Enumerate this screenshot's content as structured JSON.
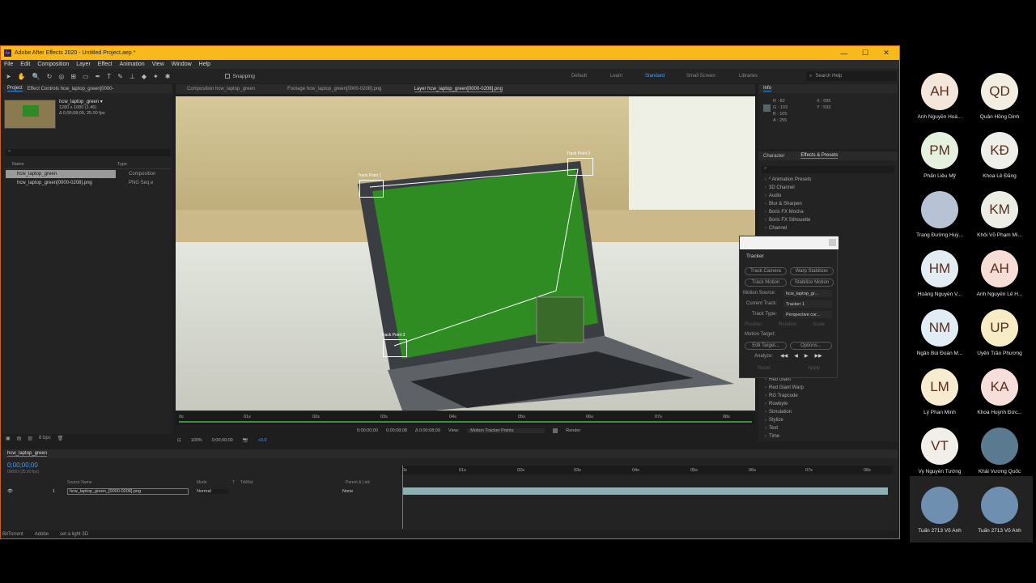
{
  "window": {
    "title": "Adobe After Effects 2020 - Untitled Project.aep *",
    "min": "—",
    "max": "☐",
    "close": "✕"
  },
  "menu": [
    "File",
    "Edit",
    "Composition",
    "Layer",
    "Effect",
    "Animation",
    "View",
    "Window",
    "Help"
  ],
  "toolbar": {
    "snapping": "Snapping",
    "workspaces": [
      "Default",
      "Learn",
      "Standard",
      "Small Screen",
      "Libraries"
    ],
    "active_workspace": "Standard",
    "search_placeholder": "Search Help"
  },
  "project": {
    "tab": "Project",
    "tab2": "Effect Controls hcw_laptop_green[0000-",
    "thumb_name": "hcw_laptop_green ▾",
    "thumb_meta1": "1280 x 1080 (1.46)",
    "thumb_meta2": "Δ 0;00;08;09, 25.00 fps",
    "col_name": "Name",
    "col_type": "Type",
    "items": [
      {
        "name": "hcw_laptop_green",
        "type": "Composition"
      },
      {
        "name": "hcw_laptop_green[0000-0208].png",
        "type": "PNG Seq.e"
      }
    ],
    "bpc": "8 bpc"
  },
  "viewer_tabs": [
    "Composition hcw_laptop_green",
    "Footage hcw_laptop_green[0000-0208].png",
    "Layer hcw_laptop_green[0000-0208].png"
  ],
  "track_points": [
    "Track Point 1",
    "Track Point 2",
    "Track Point 3"
  ],
  "layer_ruler": [
    "0s",
    "01s",
    "02s",
    "03s",
    "04s",
    "05s",
    "06s",
    "07s",
    "08s"
  ],
  "viewer_controls": {
    "in": "0;00;00;00",
    "out": "0;00;08;08",
    "dur": "Δ 0;00;08;09",
    "view_label": "View:",
    "view_value": "Motion Tracker Points",
    "render": "Render",
    "zoom": "100%",
    "time": "0;00;00;00",
    "offset": "+0.0"
  },
  "info": {
    "tab": "Info",
    "R": "R : 82",
    "G": "G : 103",
    "B": "B : 105",
    "A": "A : 255",
    "X": "X : 695",
    "Y": "Y : 593"
  },
  "effects": {
    "tab1": "Character",
    "tab2": "Effects & Presets",
    "items": [
      "* Animation Presets",
      "3D Channel",
      "Audio",
      "Blur & Sharpen",
      "Boris FX Mocha",
      "Boris FX Silhouette",
      "Channel"
    ],
    "items_lower": [
      "Red Giant",
      "Red Giant Warp",
      "RG Trapcode",
      "Rowbyte",
      "Simulation",
      "Stylize",
      "Text",
      "Time"
    ]
  },
  "tracker": {
    "title": "Tracker",
    "track_camera": "Track Camera",
    "warp_stabilizer": "Warp Stabilizer",
    "track_motion": "Track Motion",
    "stabilize_motion": "Stabilize Motion",
    "motion_source_label": "Motion Source:",
    "motion_source": "hcw_laptop_gr...",
    "current_track_label": "Current Track:",
    "current_track": "Tracker 1",
    "track_type_label": "Track Type:",
    "track_type": "Perspective cor...",
    "position": "Position",
    "rotation": "Rotation",
    "scale": "Scale",
    "motion_target": "Motion Target:",
    "edit_target": "Edit Target...",
    "options": "Options...",
    "analyze": "Analyze:",
    "reset": "Reset",
    "apply": "Apply"
  },
  "timeline": {
    "tab": "hcw_laptop_green",
    "time": "0;00;00;00",
    "fps": "00000 (25.00 fps)",
    "cols": {
      "source": "Source Name",
      "mode": "Mode",
      "t": "T",
      "trkmat": "TrkMat",
      "parent": "Parent & Link"
    },
    "layer": {
      "num": "1",
      "name": "hcw_laptop_green_[0000-0208].png",
      "mode": "Normal",
      "parent": "None"
    },
    "ruler": [
      "0s",
      "01s",
      "02s",
      "03s",
      "04s",
      "05s",
      "06s",
      "07s",
      "08s"
    ]
  },
  "taskbar": [
    "BitTorrent",
    "Adobe",
    "set a light 3D"
  ],
  "participants": [
    {
      "initials": "AH",
      "name": "Anh Nguyễn Hoà...",
      "color": "#f5e6dc"
    },
    {
      "initials": "QD",
      "name": "Quân Hồng Dinh",
      "color": "#f2efe2"
    },
    {
      "initials": "PM",
      "name": "Phấn Liêu Mỹ",
      "color": "#e6f0de"
    },
    {
      "initials": "KĐ",
      "name": "Khoa Lê Đăng",
      "color": "#eeeeea"
    },
    {
      "initials": "",
      "name": "Trang Đường Huỳ...",
      "color": "#b7c3d4"
    },
    {
      "initials": "KM",
      "name": "Khôi Võ Phạm Mi...",
      "color": "#eceee6"
    },
    {
      "initials": "HM",
      "name": "Hoàng Nguyễn V...",
      "color": "#e2ecf2"
    },
    {
      "initials": "AH",
      "name": "Anh Nguyễn Lê H...",
      "color": "#f6ded6"
    },
    {
      "initials": "NM",
      "name": "Ngân Bùi Đoàn M...",
      "color": "#e2ecf4"
    },
    {
      "initials": "UP",
      "name": "Uyên Trần Phương",
      "color": "#f8ecc6"
    },
    {
      "initials": "LM",
      "name": "Lý Phan Minh",
      "color": "#f8ecd0"
    },
    {
      "initials": "KA",
      "name": "Khoa Huỳnh Đức...",
      "color": "#f6dfda"
    },
    {
      "initials": "VT",
      "name": "Vy Nguyễn Tường",
      "color": "#f2eeea"
    },
    {
      "initials": "",
      "name": "Khải Vương Quốc",
      "color": "#5a7a90"
    },
    {
      "initials": "",
      "name": "Tuấn 2713 Võ Anh",
      "color": "#6f8fb0"
    },
    {
      "initials": "",
      "name": "Tuấn 2713 Võ Anh",
      "color": "#6f8fb0"
    }
  ]
}
